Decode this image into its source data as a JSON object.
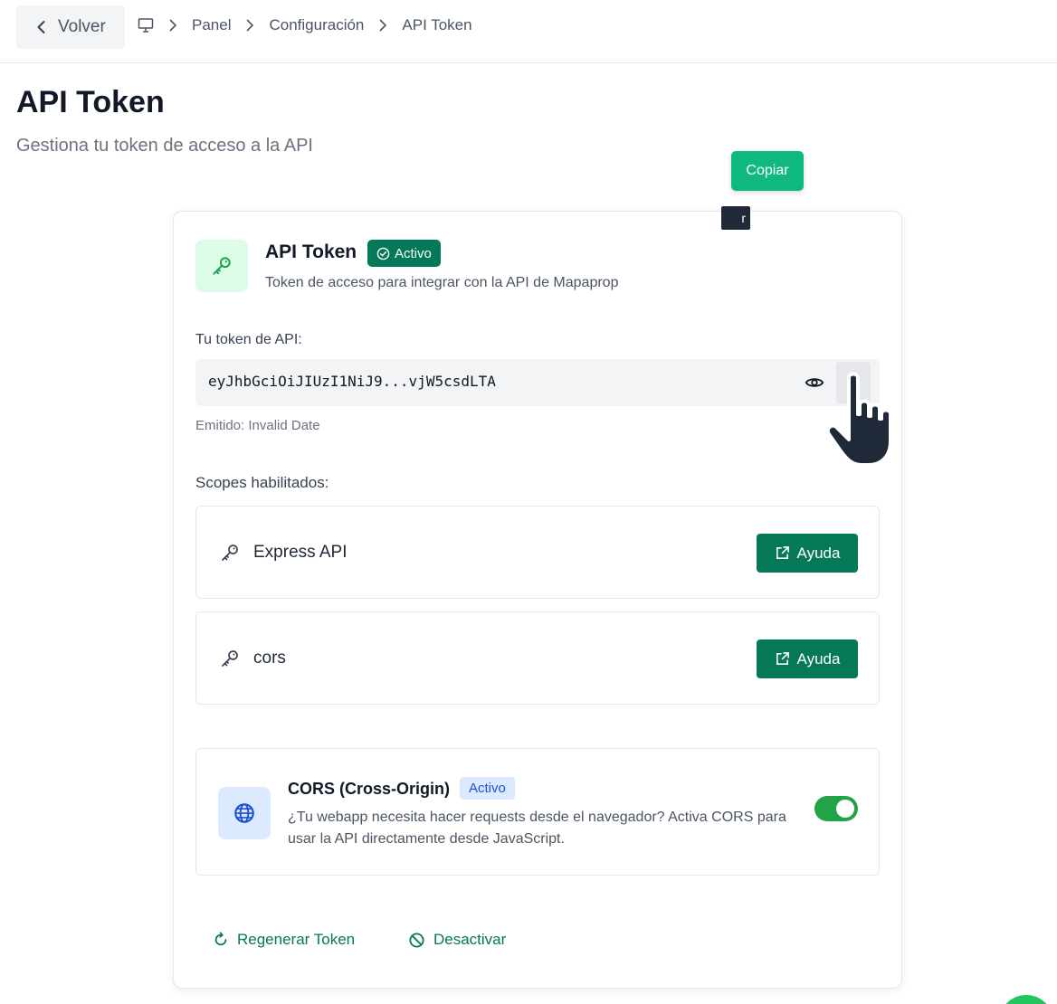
{
  "topbar": {
    "back_label": "Volver",
    "breadcrumb": [
      "Panel",
      "Configuración",
      "API Token"
    ]
  },
  "page": {
    "title": "API Token",
    "subtitle": "Gestiona tu token de acceso a la API"
  },
  "card": {
    "title": "API Token",
    "status_badge": "Activo",
    "description": "Token de acceso para integrar con la API de Mapaprop",
    "token_label": "Tu token de API:",
    "token_value": "eyJhbGciOiJIUzI1NiJ9...vjW5csdLTA",
    "copy_tooltip": "Copiar",
    "tooltip_fragment": "r",
    "issued": "Emitido: Invalid Date",
    "scopes_label": "Scopes habilitados:",
    "scopes": [
      {
        "name": "Express API",
        "help_label": "Ayuda"
      },
      {
        "name": "cors",
        "help_label": "Ayuda"
      }
    ],
    "cors": {
      "title": "CORS (Cross-Origin)",
      "badge": "Activo",
      "description": "¿Tu webapp necesita hacer requests desde el navegador? Activa CORS para usar la API directamente desde JavaScript.",
      "enabled": true
    },
    "actions": {
      "regenerate": "Regenerar Token",
      "deactivate": "Desactivar"
    }
  },
  "colors": {
    "primary": "#047857",
    "copy_button": "#10b981",
    "toggle_on": "#22a34a",
    "info_badge_bg": "#dbeafe",
    "info_badge_text": "#1d4ed8"
  },
  "icons": [
    "chevron-left-icon",
    "monitor-icon",
    "chevron-right-icon",
    "key-icon",
    "check-circle-icon",
    "eye-icon",
    "clipboard-icon",
    "external-link-icon",
    "globe-icon",
    "refresh-icon",
    "ban-icon",
    "hand-cursor-icon"
  ]
}
